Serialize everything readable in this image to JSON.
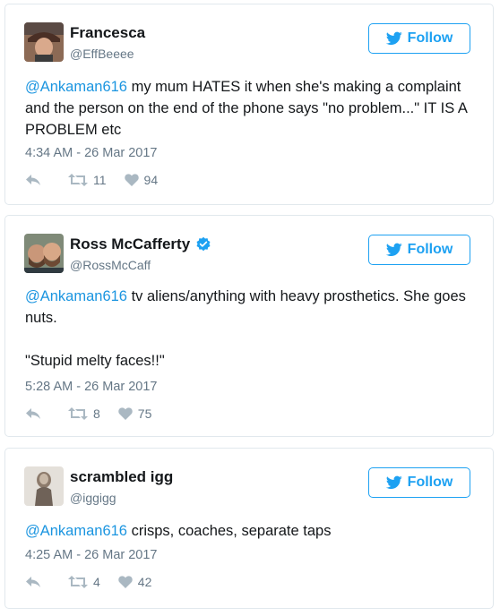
{
  "follow_label": "Follow",
  "colors": {
    "accent": "#1da1f2",
    "link": "#1b95e0",
    "muted": "#657786",
    "border": "#e1e8ed"
  },
  "tweets": [
    {
      "display_name": "Francesca",
      "handle": "@EffBeeee",
      "verified": false,
      "mention": "@Ankaman616",
      "text_lines": [
        " my mum HATES it when she's making a complaint and the person on the end of the phone says \"no problem...\" IT IS A PROBLEM etc"
      ],
      "timestamp": "4:34 AM - 26 Mar 2017",
      "retweets": "11",
      "likes": "94"
    },
    {
      "display_name": "Ross McCafferty",
      "handle": "@RossMcCaff",
      "verified": true,
      "mention": "@Ankaman616",
      "text_first": " tv aliens/anything with heavy prosthetics. She goes nuts.",
      "text_second": "\"Stupid melty faces!!\"",
      "timestamp": "5:28 AM - 26 Mar 2017",
      "retweets": "8",
      "likes": "75"
    },
    {
      "display_name": "scrambled igg",
      "handle": "@iggigg",
      "verified": false,
      "mention": "@Ankaman616",
      "text_first": " crisps, coaches, separate taps",
      "timestamp": "4:25 AM - 26 Mar 2017",
      "retweets": "4",
      "likes": "42"
    }
  ]
}
